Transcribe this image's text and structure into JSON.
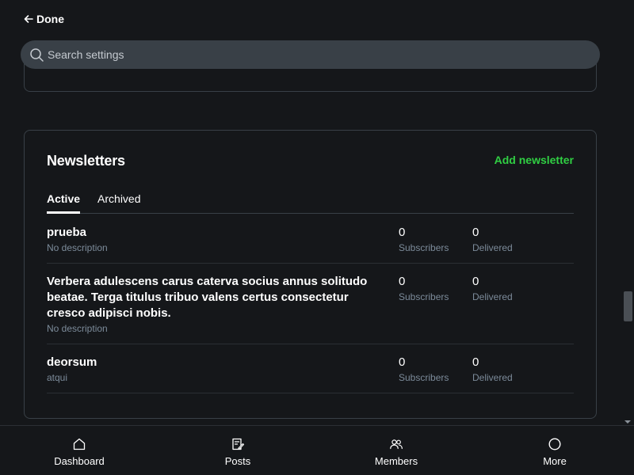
{
  "header": {
    "done_label": "Done"
  },
  "search": {
    "placeholder": "Search settings"
  },
  "newsletters": {
    "title": "Newsletters",
    "add_label": "Add newsletter",
    "tabs": [
      {
        "label": "Active",
        "active": true
      },
      {
        "label": "Archived",
        "active": false
      }
    ],
    "stat_labels": {
      "subscribers": "Subscribers",
      "delivered": "Delivered"
    },
    "items": [
      {
        "name": "prueba",
        "description": "No description",
        "subscribers": "0",
        "delivered": "0"
      },
      {
        "name": "Verbera adulescens carus caterva socius annus solitudo beatae. Terga titulus tribuo valens certus consectetur cresco adipisci nobis.",
        "description": "No description",
        "subscribers": "0",
        "delivered": "0"
      },
      {
        "name": "deorsum",
        "description": "atqui",
        "subscribers": "0",
        "delivered": "0"
      }
    ]
  },
  "bottom_nav": [
    {
      "label": "Dashboard",
      "icon": "home-icon"
    },
    {
      "label": "Posts",
      "icon": "posts-icon"
    },
    {
      "label": "Members",
      "icon": "members-icon"
    },
    {
      "label": "More",
      "icon": "more-icon"
    }
  ],
  "colors": {
    "accent": "#30cf43",
    "background": "#15171a",
    "muted": "#7c8b9a"
  }
}
